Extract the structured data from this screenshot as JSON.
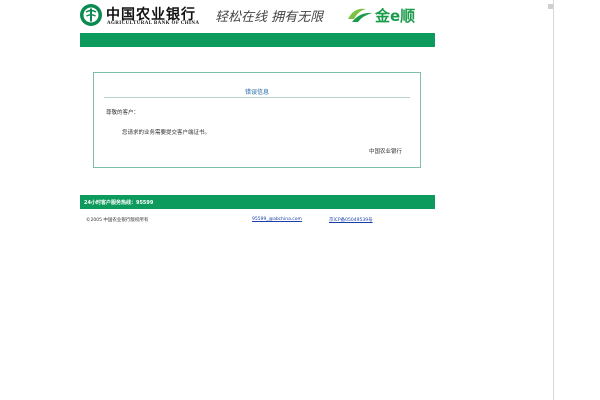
{
  "header": {
    "bank_name_cn": "中国农业银行",
    "bank_name_en": "AGRICULTURAL BANK OF CHINA",
    "slogan": "轻松在线  拥有无限",
    "brand": "金e顺"
  },
  "notice": {
    "title": "错误信息",
    "greeting": "尊敬的客户：",
    "message": "您请求的业务需要提交客户端证书。",
    "signature": "中国农业银行"
  },
  "hotline": {
    "label": "24小时客户服务热线：95599"
  },
  "footer": {
    "left_text": "©2005 中国农业银行版权所有",
    "email": "95599_@abchina.com",
    "link": "京ICP备05049539号"
  },
  "colors": {
    "brand_green": "#0d9a5d",
    "link_blue": "#1a3fa8",
    "title_blue": "#1f6aa6"
  },
  "icons": {
    "logo": "abc-bank-logo-icon",
    "brand": "swoosh-logo-icon"
  }
}
